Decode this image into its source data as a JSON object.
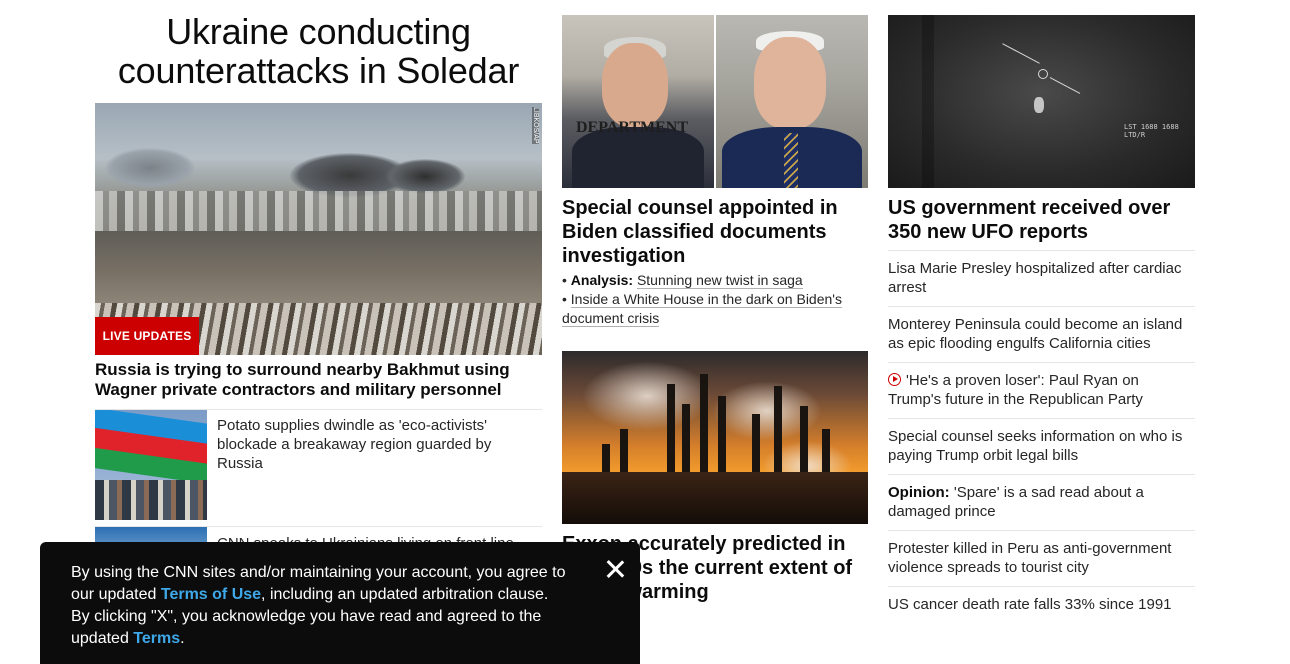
{
  "col1": {
    "headline": "Ukraine conducting counterattacks in Soledar",
    "hero_credit": "LIBKOS/AP",
    "live_badge": "LIVE UPDATES",
    "hero_sub": "Russia is trying to surround nearby Bakhmut using Wagner private contractors and military personnel",
    "stories": [
      {
        "text": "Potato supplies dwindle as 'eco-activists' blockade a breakaway region guarded by Russia"
      },
      {
        "text": "CNN speaks to Ukrainians living on front line"
      }
    ]
  },
  "col2": {
    "split_image_text": "DEPARTMENT",
    "headline": "Special counsel appointed in Biden classified documents investigation",
    "bullets": [
      {
        "bullet": "•",
        "prefix": "Analysis:",
        "text": "Stunning new twist in saga"
      },
      {
        "bullet": "•",
        "prefix": "",
        "text": "Inside a White House in the dark on Biden's document crisis"
      }
    ],
    "headline2": "Exxon accurately predicted in the 1970s the current extent of global warming"
  },
  "col3": {
    "headline": "US government received over 350 new UFO reports",
    "hud_top": "LST 1688 1688 LTD/R",
    "list": [
      {
        "prefix": "",
        "text": "Lisa Marie Presley hospitalized after cardiac arrest",
        "icon": ""
      },
      {
        "prefix": "",
        "text": "Monterey Peninsula could become an island as epic flooding engulfs California cities",
        "icon": ""
      },
      {
        "prefix": "",
        "text": "'He's a proven loser': Paul Ryan on Trump's future in the Republican Party",
        "icon": "play-icon"
      },
      {
        "prefix": "",
        "text": "Special counsel seeks information on who is paying Trump orbit legal bills",
        "icon": ""
      },
      {
        "prefix": "Opinion:",
        "text": "'Spare' is a sad read about a damaged prince",
        "icon": ""
      },
      {
        "prefix": "",
        "text": "Protester killed in Peru as anti-government violence spreads to tourist city",
        "icon": ""
      },
      {
        "prefix": "",
        "text": "US cancer death rate falls 33% since 1991",
        "icon": ""
      }
    ]
  },
  "terms_banner": {
    "text_1": "By using the CNN sites and/or maintaining your account, you agree to our updated ",
    "link_1": "Terms of Use",
    "text_2": ", including an updated arbitration clause. By clicking \"X\", you acknowledge you have read and agreed to the updated ",
    "link_2": "Terms",
    "text_3": ".",
    "close_icon": "close-icon"
  },
  "colors": {
    "live_red": "#cc0000",
    "link_blue": "#3ea8e8",
    "banner_bg": "#0c0c0c"
  }
}
